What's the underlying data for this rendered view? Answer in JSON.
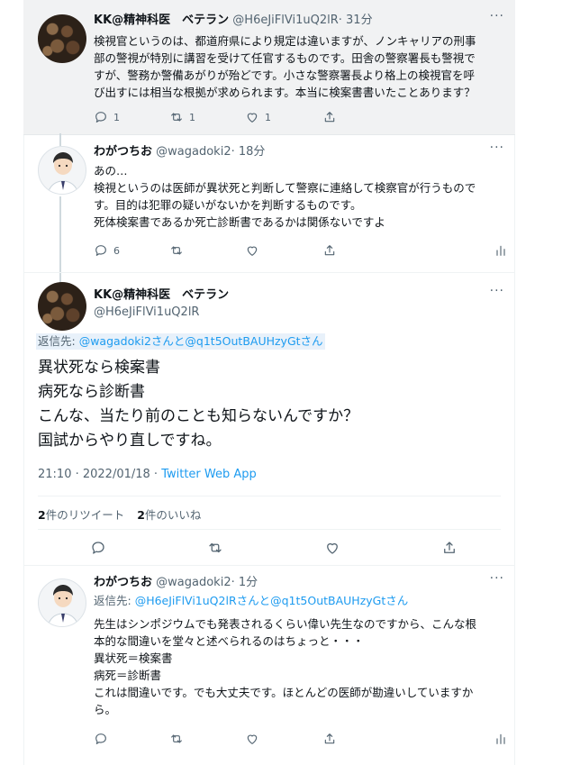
{
  "tweets": [
    {
      "name": "KK@精神科医　ベテラン",
      "handle": "@H6eJiFlVi1uQ2lR",
      "time": "· 31分",
      "lines": [
        "検視官というのは、都道府県により規定は違いますが、ノンキャリアの刑事",
        "部の警視が特別に講習を受けて任官するものです。田舎の警察署長も警視で",
        "すが、警務か警備あがりが殆どです。小さな警察署長より格上の検視官を呼",
        "び出すには相当な根拠が求められます。本当に検案書書いたことあります？"
      ],
      "counts": {
        "reply": "1",
        "retweet": "1",
        "like": "1"
      }
    },
    {
      "name": "わがつちお",
      "handle": "@wagadoki2",
      "time": "· 18分",
      "lines": [
        "あの…",
        "検視というのは医師が異状死と判断して警察に連絡して検察官が行うもので",
        "す。目的は犯罪の疑いがないかを判断するものです。",
        "死体検案書であるか死亡診断書であるかは関係ないですよ"
      ],
      "counts": {
        "reply": "6"
      }
    },
    {
      "name": "KK@精神科医　ベテラン",
      "handle": "@H6eJiFlVi1uQ2lR",
      "reply_prefix": "返信先: ",
      "reply_to": "@wagadoki2さんと@q1t5OutBAUHzyGtさん",
      "lines": [
        "異状死なら検案書",
        "病死なら診断書",
        "こんな、当たり前のことも知らないんですか？",
        "国試からやり直しですね。"
      ],
      "timestamp": "21:10 · 2022/01/18 · ",
      "source": "Twitter Web App",
      "retweets_num": "2",
      "retweets_label": "件のリツイート",
      "likes_num": "2",
      "likes_label": "件のいいね"
    },
    {
      "name": "わがつちお",
      "handle": "@wagadoki2",
      "time": "· 1分",
      "reply_prefix": "返信先: ",
      "reply_to": "@H6eJiFlVi1uQ2lRさんと@q1t5OutBAUHzyGtさん",
      "lines": [
        "先生はシンポジウムでも発表されるくらい偉い先生なのですから、こんな根",
        "本的な間違いを堂々と述べられるのはちょっと・・・",
        "異状死＝検案書",
        "病死＝診断書",
        "これは間違いです。でも大丈夫です。ほとんどの医師が勘違いしていますか",
        "ら。"
      ]
    }
  ],
  "more_label": "···",
  "icons": [
    "reply-icon",
    "retweet-icon",
    "like-icon",
    "share-icon",
    "analytics-icon",
    "more-icon"
  ]
}
